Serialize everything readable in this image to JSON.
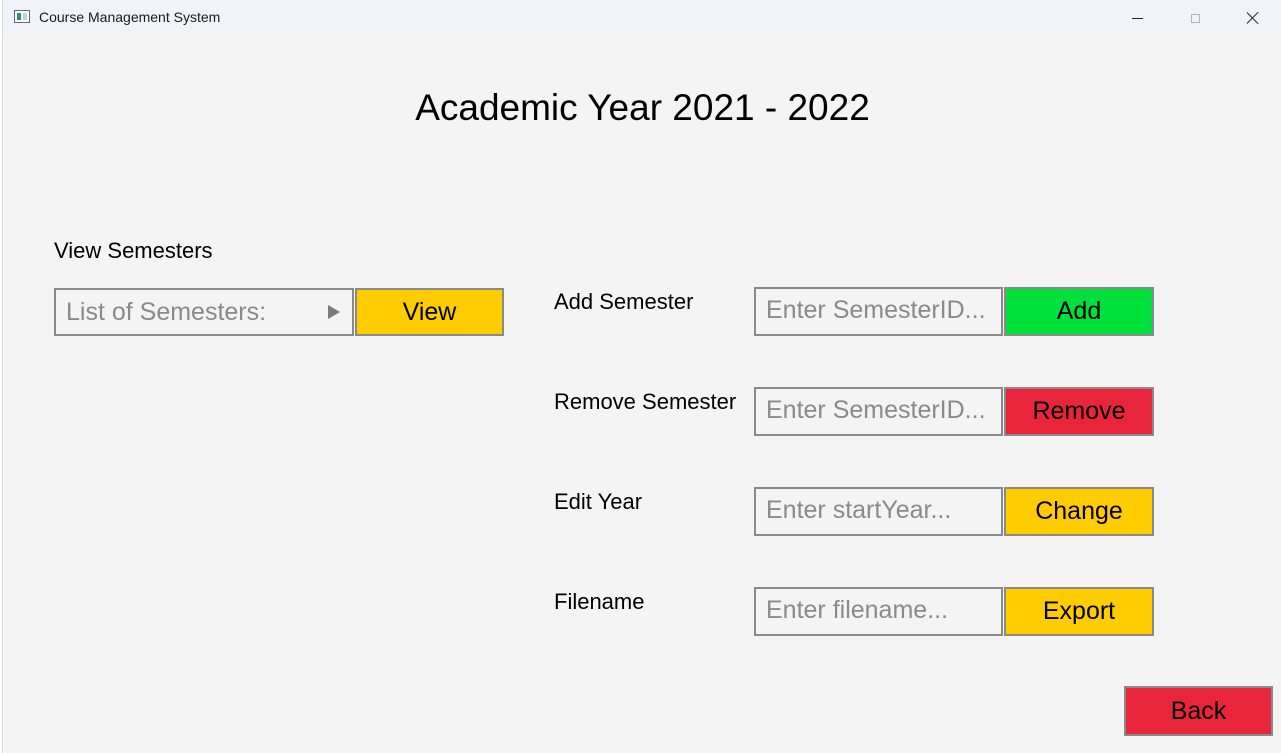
{
  "window": {
    "title": "Course Management System"
  },
  "colors": {
    "yellow": "#ffcc00",
    "green": "#00e03a",
    "red": "#e8253a"
  },
  "heading": "Academic Year 2021 - 2022",
  "view_section": {
    "label": "View Semesters",
    "dropdown_placeholder": "List of Semesters:",
    "view_button": "View"
  },
  "add_section": {
    "label": "Add Semester",
    "placeholder": "Enter SemesterID...",
    "button": "Add"
  },
  "remove_section": {
    "label": "Remove Semester",
    "placeholder": "Enter SemesterID...",
    "button": "Remove"
  },
  "edit_section": {
    "label": "Edit Year",
    "placeholder": "Enter startYear...",
    "button": "Change"
  },
  "export_section": {
    "label": "Filename",
    "placeholder": "Enter filename...",
    "button": "Export"
  },
  "back_button": "Back"
}
